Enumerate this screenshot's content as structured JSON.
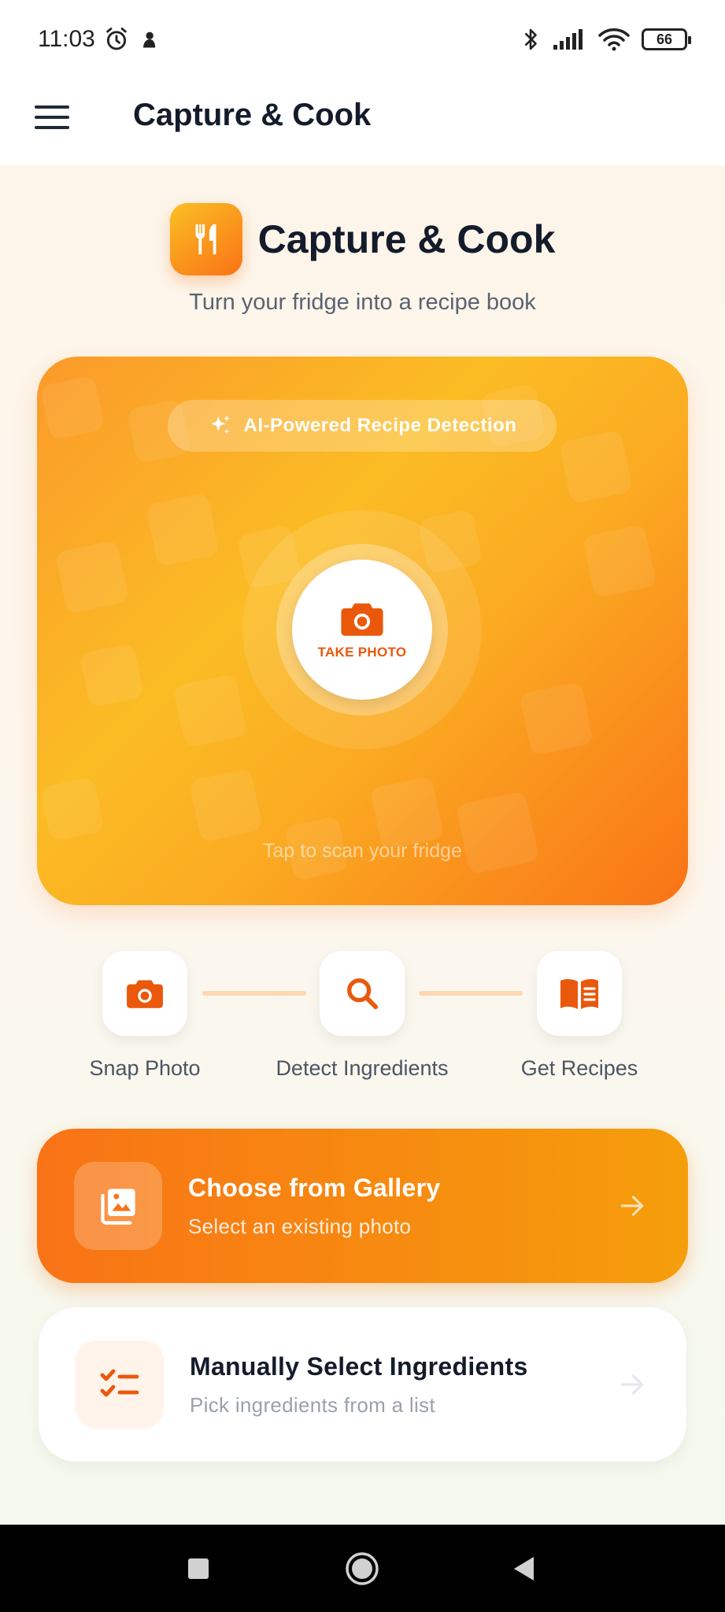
{
  "status_bar": {
    "time": "11:03",
    "battery": "66",
    "icons": [
      "alarm-icon",
      "notification-icon",
      "bluetooth-icon",
      "signal-icon",
      "wifi-icon",
      "battery-icon"
    ]
  },
  "app_bar": {
    "title": "Capture & Cook",
    "menu_icon": "hamburger-menu-icon"
  },
  "hero": {
    "title": "Capture & Cook",
    "subtitle": "Turn your fridge into a recipe book",
    "logo_icon": "fork-knife-icon"
  },
  "camera_card": {
    "badge": "AI-Powered Recipe Detection",
    "badge_icon": "sparkles-icon",
    "button_label": "TAKE PHOTO",
    "button_icon": "camera-icon",
    "hint": "Tap to scan your fridge"
  },
  "steps": [
    {
      "label": "Snap Photo",
      "icon": "camera-icon"
    },
    {
      "label": "Detect Ingredients",
      "icon": "search-icon"
    },
    {
      "label": "Get Recipes",
      "icon": "book-icon"
    }
  ],
  "gallery_card": {
    "title": "Choose from Gallery",
    "subtitle": "Select an existing photo",
    "icon": "gallery-icon"
  },
  "manual_card": {
    "title": "Manually Select Ingredients",
    "subtitle": "Pick ingredients from a list",
    "icon": "checklist-icon"
  },
  "colors": {
    "accent": "#f97316",
    "accent_light": "#fbbf24",
    "text_dark": "#141c2b",
    "text_muted": "#5b6370"
  }
}
